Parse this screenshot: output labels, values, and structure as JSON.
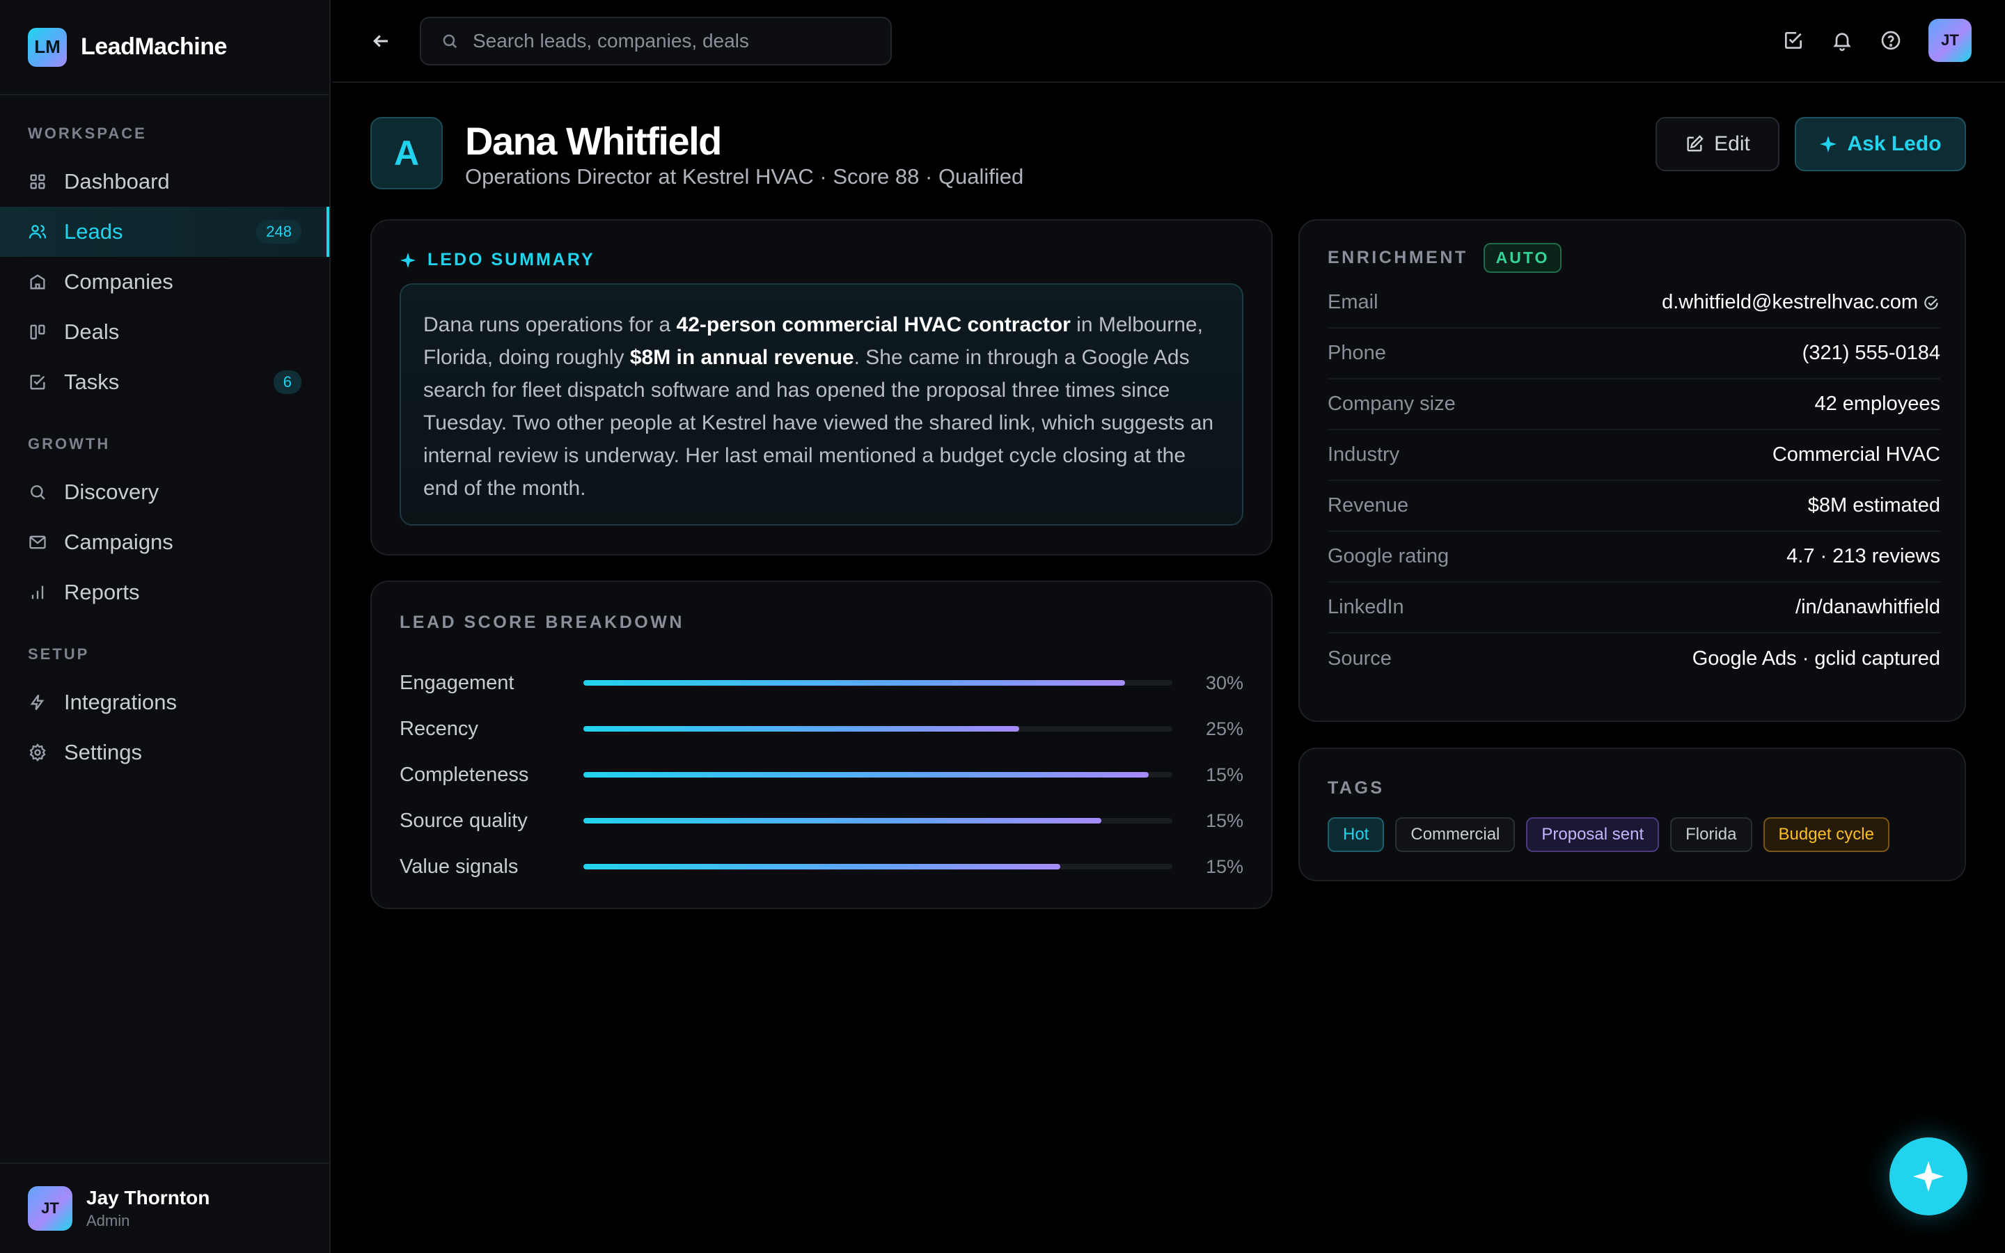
{
  "brand": {
    "logo": "LM",
    "name": "LeadMachine"
  },
  "sidebar": {
    "sections": [
      {
        "heading": "WORKSPACE",
        "items": [
          {
            "label": "Dashboard",
            "icon": "grid-icon"
          },
          {
            "label": "Leads",
            "icon": "users-icon",
            "badge": "248",
            "active": true
          },
          {
            "label": "Companies",
            "icon": "building-icon"
          },
          {
            "label": "Deals",
            "icon": "kanban-icon"
          },
          {
            "label": "Tasks",
            "icon": "checkbox-icon",
            "badge": "6"
          }
        ]
      },
      {
        "heading": "GROWTH",
        "items": [
          {
            "label": "Discovery",
            "icon": "search-icon"
          },
          {
            "label": "Campaigns",
            "icon": "mail-icon"
          },
          {
            "label": "Reports",
            "icon": "bar-chart-icon"
          }
        ]
      },
      {
        "heading": "SETUP",
        "items": [
          {
            "label": "Integrations",
            "icon": "bolt-icon"
          },
          {
            "label": "Settings",
            "icon": "gear-icon"
          }
        ]
      }
    ],
    "user": {
      "initials": "JT",
      "name": "Jay Thornton",
      "role": "Admin"
    }
  },
  "topbar": {
    "search_placeholder": "Search leads, companies, deals",
    "avatar_initials": "JT"
  },
  "lead": {
    "initial": "A",
    "name": "Dana Whitfield",
    "subtitle": "Operations Director at Kestrel HVAC · Score 88 · Qualified",
    "edit_label": "Edit",
    "ask_label": "Ask Ledo"
  },
  "summary": {
    "title": "LEDO SUMMARY",
    "parts": [
      {
        "text": "Dana runs operations for a ",
        "bold": false
      },
      {
        "text": "42-person commercial HVAC contractor",
        "bold": true
      },
      {
        "text": " in Melbourne, Florida, doing roughly ",
        "bold": false
      },
      {
        "text": "$8M in annual revenue",
        "bold": true
      },
      {
        "text": ". She came in through a Google Ads search for fleet dispatch software and has opened the proposal three times since Tuesday. Two other people at Kestrel have viewed the shared link, which suggests an internal review is underway. Her last email mentioned a budget cycle closing at the end of the month.",
        "bold": false
      }
    ]
  },
  "score_breakdown": {
    "title": "LEAD SCORE BREAKDOWN",
    "rows": [
      {
        "label": "Engagement",
        "weight": "30%",
        "fill": 0.92
      },
      {
        "label": "Recency",
        "weight": "25%",
        "fill": 0.74
      },
      {
        "label": "Completeness",
        "weight": "15%",
        "fill": 0.96
      },
      {
        "label": "Source quality",
        "weight": "15%",
        "fill": 0.88
      },
      {
        "label": "Value signals",
        "weight": "15%",
        "fill": 0.81
      }
    ]
  },
  "enrichment": {
    "title": "ENRICHMENT",
    "badge": "AUTO",
    "rows": [
      {
        "label": "Email",
        "value": "d.whitfield@kestrelhvac.com",
        "verified": true
      },
      {
        "label": "Phone",
        "value": "(321) 555-0184"
      },
      {
        "label": "Company size",
        "value": "42 employees"
      },
      {
        "label": "Industry",
        "value": "Commercial HVAC"
      },
      {
        "label": "Revenue",
        "value": "$8M estimated"
      },
      {
        "label": "Google rating",
        "value": "4.7 · 213 reviews"
      },
      {
        "label": "LinkedIn",
        "value": "/in/danawhitfield"
      },
      {
        "label": "Source",
        "value": "Google Ads · gclid captured"
      }
    ]
  },
  "tags": {
    "title": "TAGS",
    "items": [
      {
        "label": "Hot",
        "style": "hot"
      },
      {
        "label": "Commercial",
        "style": "neutral"
      },
      {
        "label": "Proposal sent",
        "style": "purple"
      },
      {
        "label": "Florida",
        "style": "neutral"
      },
      {
        "label": "Budget cycle",
        "style": "orange"
      }
    ]
  },
  "colors": {
    "accent": "#22d3ee",
    "success": "#34d399",
    "purple": "#a78bfa",
    "warning": "#fbbf24"
  }
}
